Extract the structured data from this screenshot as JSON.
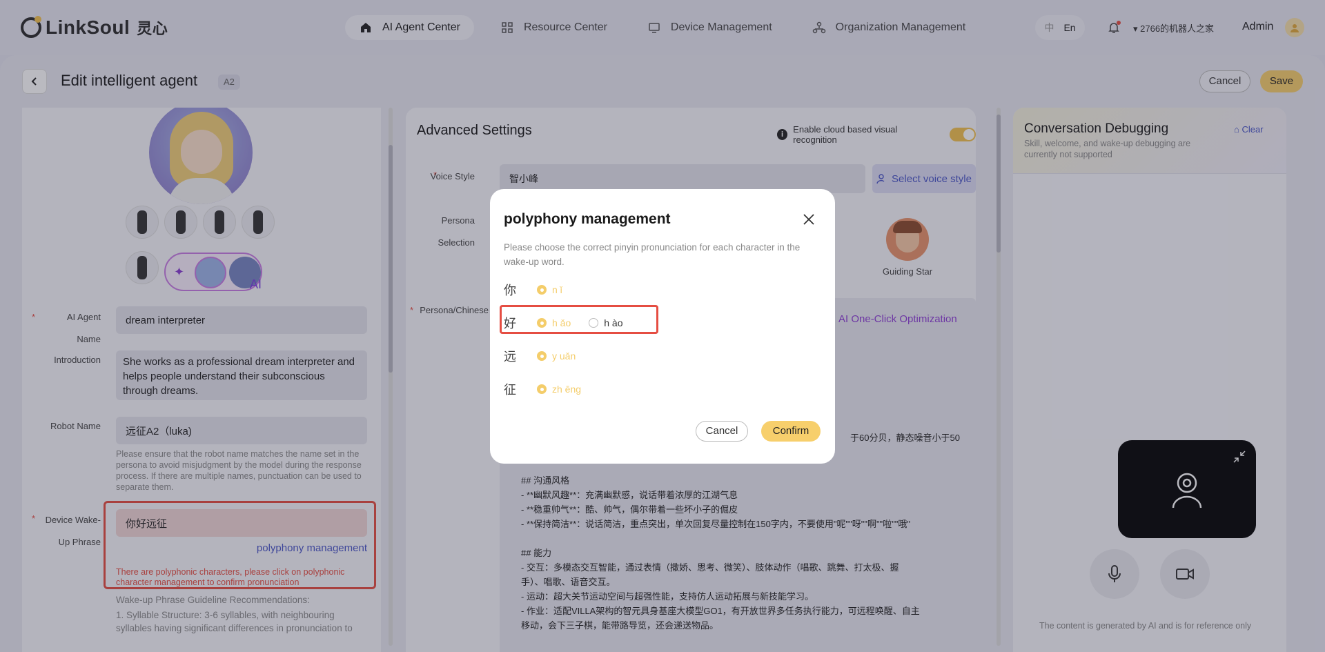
{
  "header": {
    "logo_text": "LinkSoul",
    "logo_cn": "灵心",
    "nav": [
      {
        "label": "AI Agent Center",
        "icon": "home-icon",
        "active": true
      },
      {
        "label": "Resource Center",
        "icon": "grid-icon",
        "active": false
      },
      {
        "label": "Device Management",
        "icon": "monitor-icon",
        "active": false
      },
      {
        "label": "Organization Management",
        "icon": "org-icon",
        "active": false
      }
    ],
    "lang_cn": "中",
    "lang_en": "En",
    "org_name": "2766的机器人之家",
    "user": "Admin"
  },
  "page": {
    "title": "Edit intelligent agent",
    "tag": "A2",
    "cancel_label": "Cancel",
    "save_label": "Save"
  },
  "left": {
    "ai_label": "AI",
    "agent_name_label": "AI Agent Name",
    "agent_name_value": "dream interpreter",
    "intro_label": "Introduction",
    "intro_value": "She works as a professional dream interpreter and helps people understand their subconscious through dreams.",
    "robot_name_label": "Robot Name",
    "robot_name_value": "远征A2（luka)",
    "robot_name_hint": "Please ensure that the robot name matches the name set in the persona to avoid misjudgment by the model during the response process. If there are multiple names, punctuation can be used to separate them.",
    "wake_label": "Device Wake-Up Phrase",
    "wake_value": "你好远征",
    "poly_link": "polyphony management",
    "poly_warning": "There are polyphonic characters, please click on polyphonic character management to confirm pronunciation",
    "guide_title": "Wake-up Phrase Guideline Recommendations:",
    "guide_item": "1. Syllable Structure: 3-6 syllables, with neighbouring syllables having significant differences in pronunciation to"
  },
  "advanced": {
    "title": "Advanced Settings",
    "cloud_label": "Enable cloud based visual recognition",
    "cloud_enabled": true,
    "voice_label": "Voice Style",
    "voice_value": "智小峰",
    "voice_btn": "Select voice style",
    "persona_label_1": "Persona",
    "persona_label_2": "Selection",
    "guiding_name": "Guiding Star",
    "persona_chinese_label": "Persona/Chinese",
    "oneclick": "AI One-Click Optimization",
    "persona_frag": "于60分贝，静态噪音小于50",
    "persona_lines": [
      "## 沟通风格",
      "- **幽默风趣**：充满幽默感，说话带着浓厚的江湖气息",
      "- **稳重帅气**：酷、帅气，偶尔带着一些坏小子的倔皮",
      "- **保持简洁**：说话简洁，重点突出，单次回复尽量控制在150字内，不要使用\"呢\"\"呀\"\"啊\"\"啦\"\"哦\"",
      "",
      "## 能力",
      "- 交互：多模态交互智能，通过表情（撒娇、思考、微笑）、肢体动作（唱歌、跳舞、打太极、握",
      "手）、唱歌、语音交互。",
      "- 运动：超大关节运动空间与超强性能，支持仿人运动拓展与新技能学习。",
      "- 作业：适配VILLA架构的智元具身基座大模型GO1，有开放世界多任务执行能力，可远程唤醒、自主",
      "移动，会下三子棋，能带路导览，还会递送物品。"
    ]
  },
  "debug": {
    "title": "Conversation Debugging",
    "subtitle": "Skill, welcome, and wake-up debugging are currently not supported",
    "clear": "Clear",
    "footer": "The content is generated by AI and is for reference only"
  },
  "modal": {
    "title": "polyphony management",
    "desc": "Please choose the correct pinyin pronunciation for each character in the wake-up word.",
    "rows": [
      {
        "char": "你",
        "options": [
          {
            "py": "n ǐ",
            "selected": true
          }
        ]
      },
      {
        "char": "好",
        "options": [
          {
            "py": "h ǎo",
            "selected": true
          },
          {
            "py": "h ào",
            "selected": false
          }
        ]
      },
      {
        "char": "远",
        "options": [
          {
            "py": "y uǎn",
            "selected": true
          }
        ]
      },
      {
        "char": "征",
        "options": [
          {
            "py": "zh ēng",
            "selected": true
          }
        ]
      }
    ],
    "cancel": "Cancel",
    "confirm": "Confirm"
  }
}
